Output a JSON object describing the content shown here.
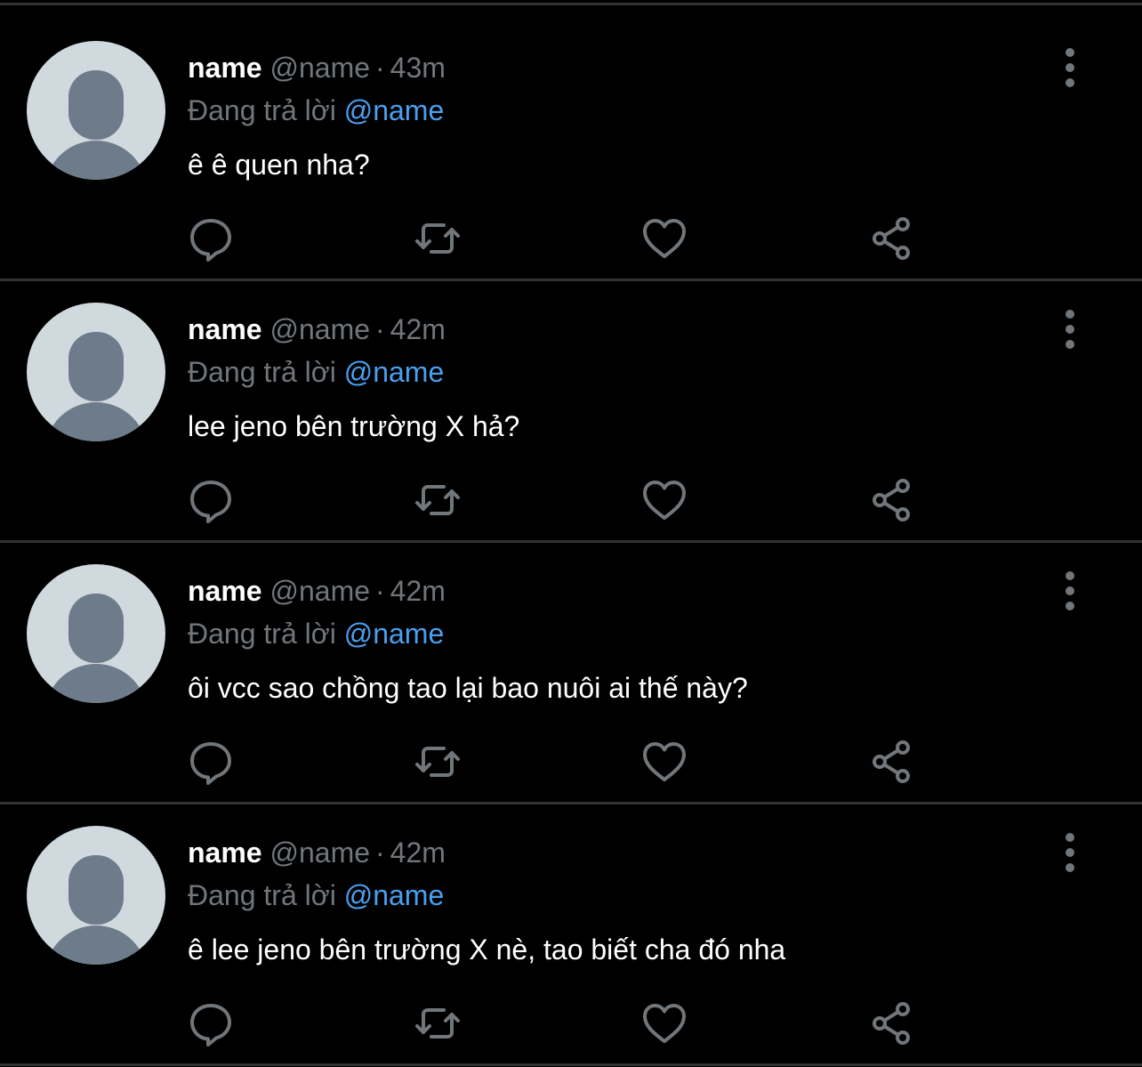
{
  "colors": {
    "background": "#000000",
    "divider": "#2f3336",
    "muted": "#71767b",
    "mention": "#4a9ff0",
    "text": "#ffffff"
  },
  "tweets": [
    {
      "name": "name",
      "handle": "@name",
      "dot": "·",
      "time": "43m",
      "reply_prefix": "Đang trả lời",
      "reply_mention": "@name",
      "text": "ê ê quen nha?"
    },
    {
      "name": "name",
      "handle": "@name",
      "dot": "·",
      "time": "42m",
      "reply_prefix": "Đang trả lời",
      "reply_mention": "@name",
      "text": "lee jeno bên trường X hả?"
    },
    {
      "name": "name",
      "handle": "@name",
      "dot": "·",
      "time": "42m",
      "reply_prefix": "Đang trả lời",
      "reply_mention": "@name",
      "text": "ôi vcc sao chồng tao lại bao nuôi ai thế này?"
    },
    {
      "name": "name",
      "handle": "@name",
      "dot": "·",
      "time": "42m",
      "reply_prefix": "Đang trả lời",
      "reply_mention": "@name",
      "text": "ê lee jeno bên trường X nè, tao biết cha đó nha"
    }
  ],
  "icons": {
    "more": "more-vertical-icon",
    "reply": "reply-icon",
    "retweet": "retweet-icon",
    "like": "heart-icon",
    "share": "share-icon"
  }
}
